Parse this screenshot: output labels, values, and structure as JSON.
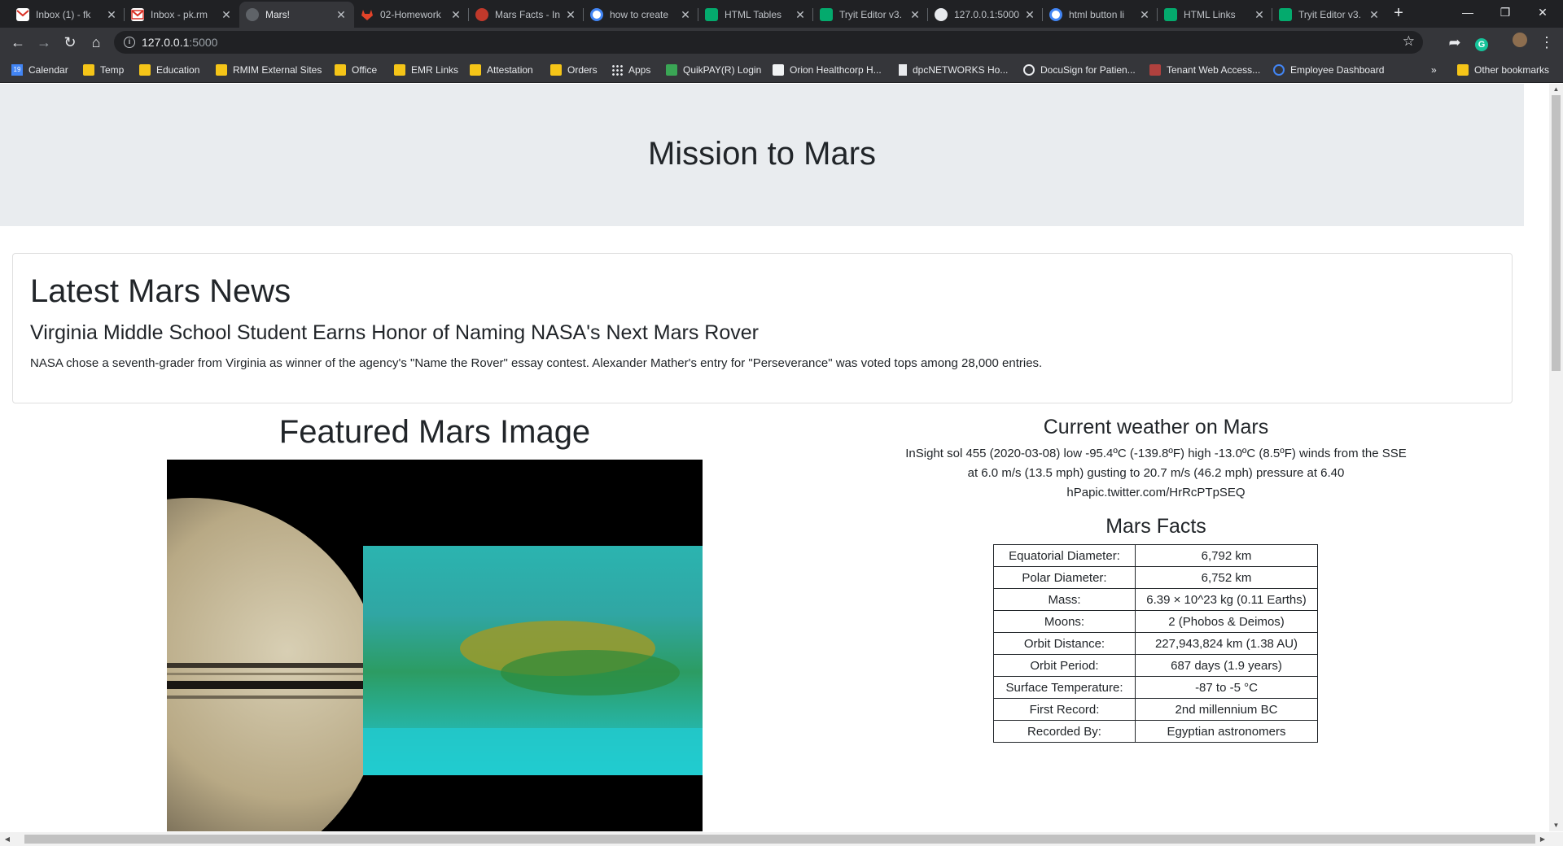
{
  "browser": {
    "tabs": [
      {
        "title": "Inbox (1) - fk",
        "favicon_color": "#d93025",
        "icon": "gmail-icon",
        "active": false
      },
      {
        "title": "Inbox - pk.rm",
        "favicon_color": "#d93025",
        "icon": "gmail-icon",
        "active": false
      },
      {
        "title": "Mars!",
        "favicon_color": "#5f6368",
        "icon": "globe-icon",
        "active": true
      },
      {
        "title": "02-Homework",
        "favicon_color": "#e24329",
        "icon": "gitlab-icon",
        "active": false
      },
      {
        "title": "Mars Facts - In",
        "favicon_color": "#c0392b",
        "icon": "mars-icon",
        "active": false
      },
      {
        "title": "how to create",
        "favicon_color": "#4285f4",
        "icon": "google-icon",
        "active": false
      },
      {
        "title": "HTML Tables",
        "favicon_color": "#04aa6d",
        "icon": "w3schools-icon",
        "active": false
      },
      {
        "title": "Tryit Editor v3.",
        "favicon_color": "#04aa6d",
        "icon": "w3schools-icon",
        "active": false
      },
      {
        "title": "127.0.0.1:5000",
        "favicon_color": "#9aa0a6",
        "icon": "globe-icon",
        "active": false
      },
      {
        "title": "html button li",
        "favicon_color": "#4285f4",
        "icon": "google-icon",
        "active": false
      },
      {
        "title": "HTML Links",
        "favicon_color": "#04aa6d",
        "icon": "w3schools-icon",
        "active": false
      },
      {
        "title": "Tryit Editor v3.",
        "favicon_color": "#04aa6d",
        "icon": "w3schools-icon",
        "active": false
      }
    ],
    "address": {
      "host": "127.0.0.1",
      "port": ":5000"
    },
    "bookmarks": [
      {
        "label": "Calendar",
        "icon": "calendar-icon"
      },
      {
        "label": "Temp",
        "icon": "folder-icon"
      },
      {
        "label": "Education",
        "icon": "folder-icon"
      },
      {
        "label": "RMIM External Sites",
        "icon": "folder-icon"
      },
      {
        "label": "Office",
        "icon": "folder-icon"
      },
      {
        "label": "EMR Links",
        "icon": "folder-icon"
      },
      {
        "label": "Attestation",
        "icon": "folder-icon"
      },
      {
        "label": "Orders",
        "icon": "folder-icon"
      },
      {
        "label": "Apps",
        "icon": "apps-grid-icon"
      },
      {
        "label": "QuikPAY(R) Login",
        "icon": "quikpay-icon"
      },
      {
        "label": "Orion Healthcorp H...",
        "icon": "orion-icon"
      },
      {
        "label": "dpcNETWORKS Ho...",
        "icon": "page-icon"
      },
      {
        "label": "DocuSign for Patien...",
        "icon": "docusign-icon"
      },
      {
        "label": "Tenant Web Access...",
        "icon": "tenant-icon"
      },
      {
        "label": "Employee Dashboard",
        "icon": "dashboard-icon"
      }
    ],
    "other_bookmarks": "Other bookmarks"
  },
  "page": {
    "title": "Mission to Mars",
    "news": {
      "heading": "Latest Mars News",
      "headline": "Virginia Middle School Student Earns Honor of Naming NASA's Next Mars Rover",
      "teaser": "NASA chose a seventh-grader from Virginia as winner of the agency's \"Name the Rover\" essay contest. Alexander Mather's entry for \"Perseverance\" was voted tops among 28,000 entries."
    },
    "featured": {
      "heading": "Featured Mars Image"
    },
    "weather": {
      "heading": "Current weather on Mars",
      "text": "InSight sol 455 (2020-03-08) low -95.4ºC (-139.8ºF) high -13.0ºC (8.5ºF) winds from the SSE at 6.0 m/s (13.5 mph) gusting to 20.7 m/s (46.2 mph) pressure at 6.40 hPapic.twitter.com/HrRcPTpSEQ"
    },
    "facts": {
      "heading": "Mars Facts",
      "rows": [
        {
          "label": "Equatorial Diameter:",
          "value": "6,792 km"
        },
        {
          "label": "Polar Diameter:",
          "value": "6,752 km"
        },
        {
          "label": "Mass:",
          "value": "6.39 × 10^23 kg (0.11 Earths)"
        },
        {
          "label": "Moons:",
          "value": "2 (Phobos & Deimos)"
        },
        {
          "label": "Orbit Distance:",
          "value": "227,943,824 km (1.38 AU)"
        },
        {
          "label": "Orbit Period:",
          "value": "687 days (1.9 years)"
        },
        {
          "label": "Surface Temperature:",
          "value": "-87 to -5 °C"
        },
        {
          "label": "First Record:",
          "value": "2nd millennium BC"
        },
        {
          "label": "Recorded By:",
          "value": "Egyptian astronomers"
        }
      ]
    }
  }
}
